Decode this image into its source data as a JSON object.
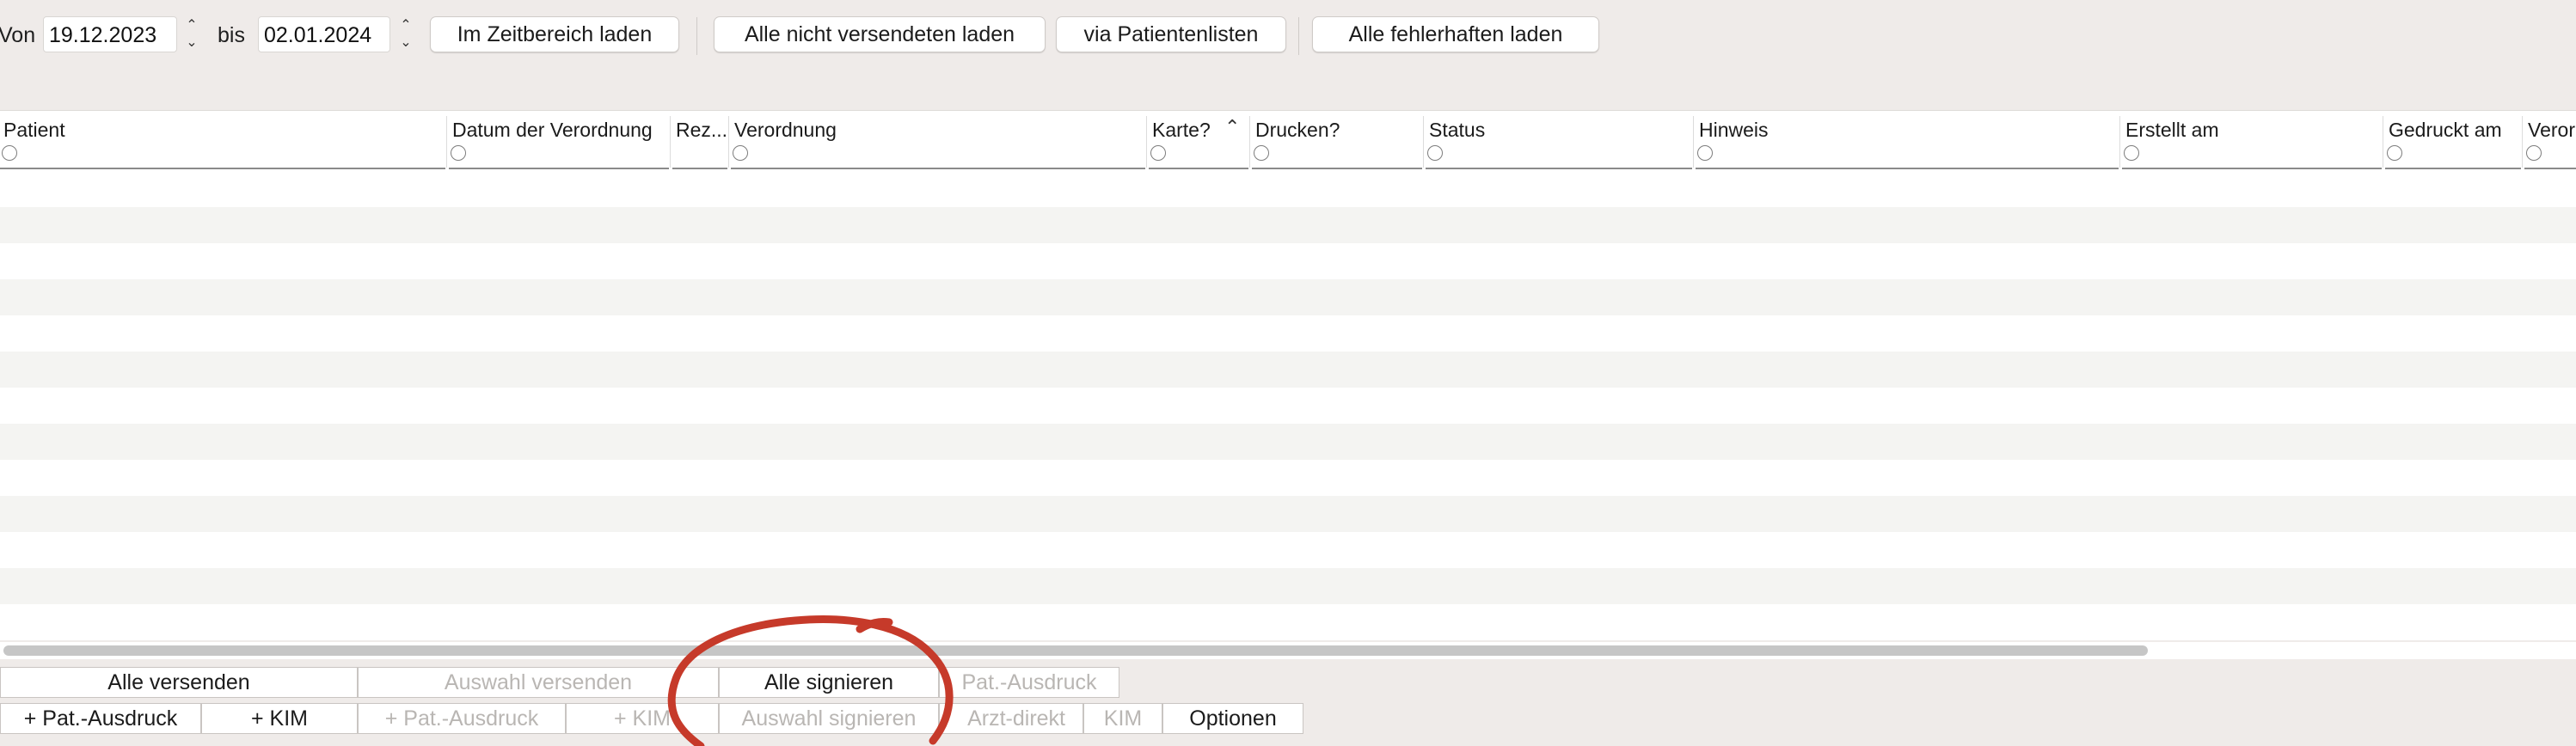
{
  "toolbar": {
    "from_label": "Von",
    "from_date": "19.12.2023",
    "to_label": "bis",
    "to_date": "02.01.2024",
    "btn_load_range": "Im Zeitbereich laden",
    "btn_load_unsent": "Alle nicht versendeten laden",
    "btn_patient_lists": "via Patientenlisten",
    "btn_load_faulty": "Alle fehlerhaften laden"
  },
  "table": {
    "columns": [
      "Patient",
      "Datum der Verordnung",
      "Rez...",
      "Verordnung",
      "Karte?",
      "Drucken?",
      "Status",
      "Hinweis",
      "Erstellt am",
      "Gedruckt am",
      "Veror"
    ],
    "sorted_column": "Karte?",
    "sort_direction": "ascending",
    "row_count_visible": 13
  },
  "bottom": {
    "row1": {
      "send_all": "Alle versenden",
      "send_selection": "Auswahl versenden",
      "sign_all": "Alle signieren",
      "pat_print": "Pat.-Ausdruck"
    },
    "row2": {
      "plus_pat_print_1": "+ Pat.-Ausdruck",
      "plus_kim_1": "+ KIM",
      "plus_pat_print_2": "+ Pat.-Ausdruck",
      "plus_kim_2": "+ KIM",
      "sign_selection": "Auswahl signieren",
      "doctor_direct": "Arzt-direkt",
      "kim": "KIM",
      "options": "Optionen"
    }
  },
  "colors": {
    "background": "#efebe9",
    "annotation": "#c63a2a",
    "row_alt": "#f4f4f2",
    "disabled_text": "#b9b6b3"
  }
}
